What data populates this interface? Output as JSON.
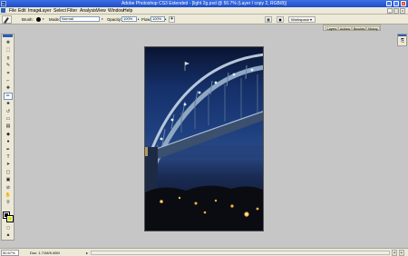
{
  "window": {
    "title": "Adobe Photoshop CS3 Extended - [light 2g.psd @ 50.7% (Layer / copy 2, RGB/8)]",
    "logo": "Ps",
    "buttons": {
      "minimize": "_",
      "restore": "□",
      "close": "x"
    }
  },
  "menubar": {
    "items": [
      "File",
      "Edit",
      "Image",
      "Layer",
      "Select",
      "Filter",
      "Analysis",
      "View",
      "Window",
      "Help"
    ],
    "doc_buttons": {
      "minimize": "_",
      "restore": "□",
      "close": "x"
    }
  },
  "options": {
    "brush_label": "Brush:",
    "brush_size": "●",
    "mode_label": "Mode:",
    "mode_value": "Normal",
    "opacity_label": "Opacity:",
    "opacity_value": "100%",
    "flow_label": "Flow:",
    "flow_value": "100%",
    "workspace_label": "Workspace ▾"
  },
  "palette_well": {
    "tabs": [
      "Layers",
      "Actions",
      "Brushes",
      "History"
    ]
  },
  "toolbox": {
    "tools": [
      {
        "name": "move-tool",
        "glyph": "✥"
      },
      {
        "name": "marquee-tool",
        "glyph": "⬚"
      },
      {
        "name": "lasso-tool",
        "glyph": "ϙ"
      },
      {
        "name": "quick-selection-tool",
        "glyph": "✎"
      },
      {
        "name": "crop-tool",
        "glyph": "⌗"
      },
      {
        "name": "slice-tool",
        "glyph": "⌐"
      },
      {
        "name": "healing-brush-tool",
        "glyph": "✚"
      },
      {
        "name": "brush-tool",
        "glyph": "✏"
      },
      {
        "name": "clone-stamp-tool",
        "glyph": "♣"
      },
      {
        "name": "history-brush-tool",
        "glyph": "↺"
      },
      {
        "name": "eraser-tool",
        "glyph": "▭"
      },
      {
        "name": "gradient-tool",
        "glyph": "▤"
      },
      {
        "name": "blur-tool",
        "glyph": "◆"
      },
      {
        "name": "dodge-tool",
        "glyph": "●"
      },
      {
        "name": "pen-tool",
        "glyph": "✒"
      },
      {
        "name": "type-tool",
        "glyph": "T"
      },
      {
        "name": "path-selection-tool",
        "glyph": "➤"
      },
      {
        "name": "shape-tool",
        "glyph": "▢"
      },
      {
        "name": "notes-tool",
        "glyph": "▣"
      },
      {
        "name": "eyedropper-tool",
        "glyph": "⊘"
      },
      {
        "name": "hand-tool",
        "glyph": "✋"
      },
      {
        "name": "zoom-tool",
        "glyph": "⚲"
      }
    ],
    "active_tool": "brush-tool",
    "foreground_color": "#000000",
    "background_color": "#d7ea00",
    "mode_buttons": [
      "▢",
      "◙",
      "▭"
    ]
  },
  "right_panel": {
    "icon": "⎘"
  },
  "status": {
    "zoom": "50.67%",
    "doc_info": "Doc: 1.71M/5.40M",
    "menu_arrow": "▸",
    "scroll_left": "◂",
    "scroll_right": "▸"
  },
  "colors": {
    "title_bar": "#1f4ec4",
    "chrome": "#ece9d8",
    "workspace": "#c6c6c6"
  }
}
